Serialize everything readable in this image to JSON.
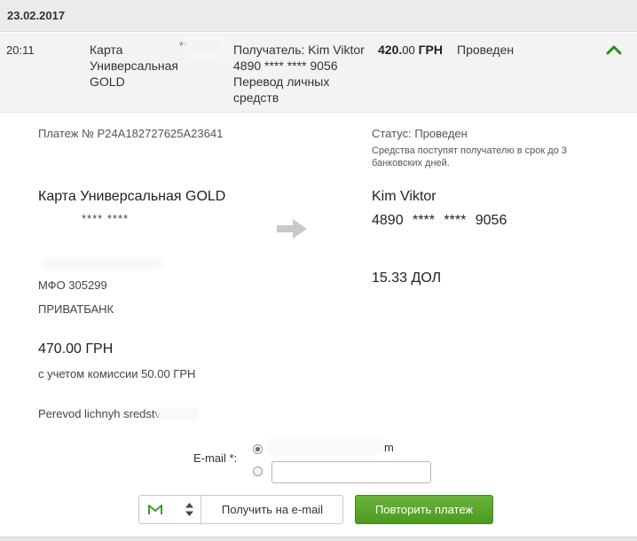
{
  "date_header": "23.02.2017",
  "summary": {
    "time": "20:11",
    "card": "Карта Универсальная GOLD",
    "card_mask": "**",
    "recipient": "Получатель: Kim Viktor 4890 **** **** 9056 Перевод личных средств",
    "amount_main": "420.",
    "amount_kop": "00",
    "amount_currency": "ГРН",
    "status": "Проведен"
  },
  "detail": {
    "payment_id": "Платеж № P24A182727625A23641",
    "status_label": "Статус: Проведен",
    "status_note": "Средства поступят получателю в срок до 3 банковских дней.",
    "sender_card": "Карта Универсальная GOLD",
    "sender_number": "****  ****",
    "mfo": "МФО 305299",
    "bank": "ПРИВАТБАНК",
    "sum": "470.00 ГРН",
    "commission": "с учетом комиссии 50.00 ГРН",
    "purpose": "Perevod lichnyh sredstv",
    "recipient_name": "Kim Viktor",
    "recipient_number": "4890 **** **** 9056",
    "recipient_amount": "15.33 ДОЛ"
  },
  "email_form": {
    "label": "E-mail *:",
    "option1_value": "m",
    "option2_value": ""
  },
  "buttons": {
    "get_email": "Получить на e-mail",
    "repeat": "Повторить платеж"
  },
  "colors": {
    "accent_green": "#4c9a20",
    "chevron_green": "#2e8b1f"
  }
}
